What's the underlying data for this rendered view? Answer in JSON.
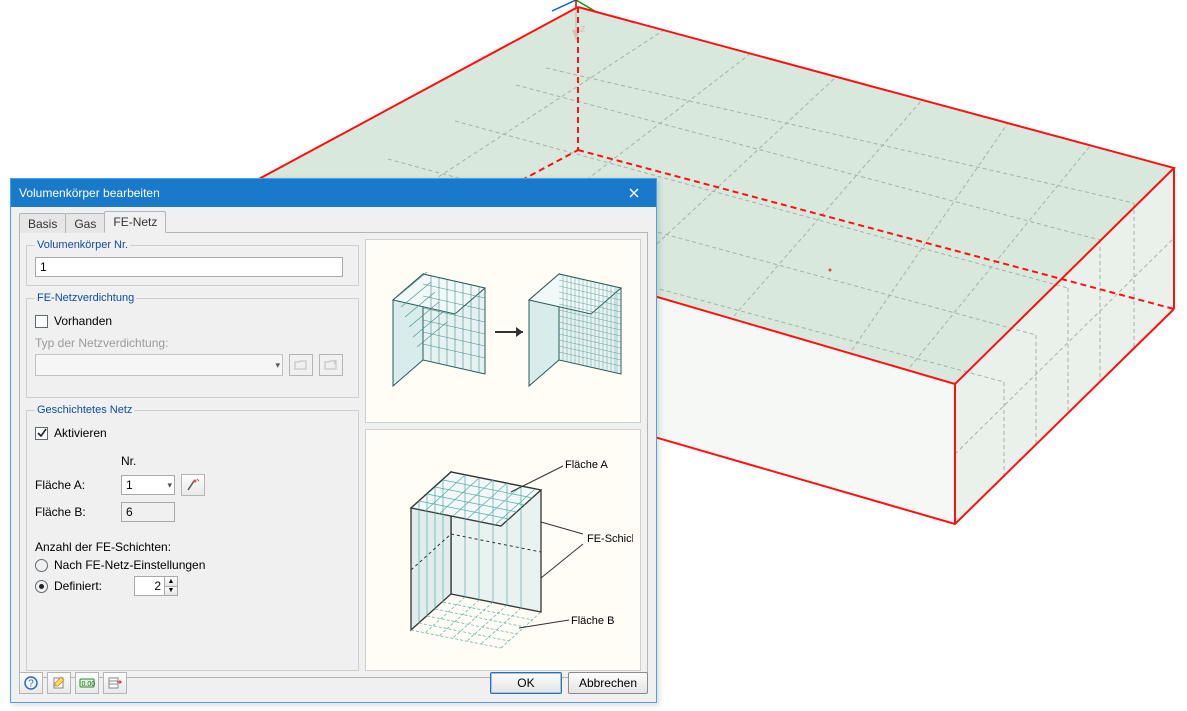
{
  "dialog": {
    "title": "Volumenkörper bearbeiten",
    "tabs": {
      "basis": "Basis",
      "gas": "Gas",
      "fenetz": "FE-Netz"
    },
    "group_nr": {
      "legend": "Volumenkörper Nr.",
      "value": "1"
    },
    "group_refine": {
      "legend": "FE-Netzverdichtung",
      "vorhanden_label": "Vorhanden",
      "vorhanden_checked": false,
      "type_label": "Typ der Netzverdichtung:",
      "type_value": ""
    },
    "group_layered": {
      "legend": "Geschichtetes Netz",
      "activate_label": "Aktivieren",
      "activate_checked": true,
      "col_nr": "Nr.",
      "face_a_label": "Fläche A:",
      "face_a_value": "1",
      "face_b_label": "Fläche B:",
      "face_b_value": "6",
      "layer_count_label": "Anzahl der FE-Schichten:",
      "opt_settings": "Nach FE-Netz-Einstellungen",
      "opt_defined": "Definiert:",
      "opt_selected": "defined",
      "defined_value": "2"
    },
    "diagram": {
      "face_a": "Fläche A",
      "fe_layers": "FE-Schichten",
      "face_b": "Fläche B"
    },
    "buttons": {
      "ok": "OK",
      "cancel": "Abbrechen"
    }
  }
}
